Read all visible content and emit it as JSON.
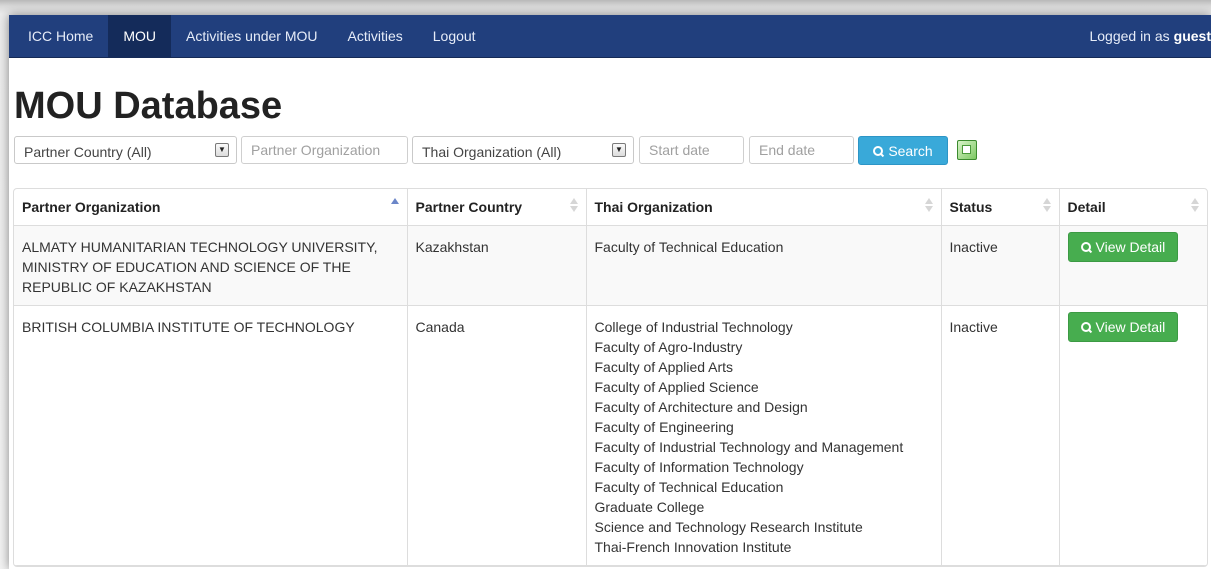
{
  "nav": {
    "items": [
      {
        "label": "ICC Home",
        "active": false
      },
      {
        "label": "MOU",
        "active": true
      },
      {
        "label": "Activities under MOU",
        "active": false
      },
      {
        "label": "Activities",
        "active": false
      },
      {
        "label": "Logout",
        "active": false
      }
    ],
    "login_prefix": "Logged in as",
    "login_user": "guest"
  },
  "page": {
    "title": "MOU Database"
  },
  "filters": {
    "partner_country": "Partner Country (All)",
    "partner_org_placeholder": "Partner Organization",
    "thai_org": "Thai Organization (All)",
    "start_date_placeholder": "Start date",
    "end_date_placeholder": "End date",
    "search_label": "Search"
  },
  "table": {
    "headers": [
      "Partner Organization",
      "Partner Country",
      "Thai Organization",
      "Status",
      "Detail"
    ],
    "sorted_column": "Partner Organization",
    "rows": [
      {
        "partner_org": "ALMATY HUMANITARIAN TECHNOLOGY UNIVERSITY, MINISTRY OF EDUCATION AND SCIENCE OF THE REPUBLIC OF KAZAKHSTAN",
        "country": "Kazakhstan",
        "thai_orgs": [
          "Faculty of Technical Education"
        ],
        "status": "Inactive",
        "detail_label": "View Detail"
      },
      {
        "partner_org": "BRITISH COLUMBIA INSTITUTE OF TECHNOLOGY",
        "country": "Canada",
        "thai_orgs": [
          "College of Industrial Technology",
          "Faculty of Agro-Industry",
          "Faculty of Applied Arts",
          "Faculty of Applied Science",
          "Faculty of Architecture and Design",
          "Faculty of Engineering",
          "Faculty of Industrial Technology and Management",
          "Faculty of Information Technology",
          "Faculty of Technical Education",
          "Graduate College",
          "Science and Technology Research Institute",
          "Thai-French Innovation Institute"
        ],
        "status": "Inactive",
        "detail_label": "View Detail"
      }
    ]
  },
  "colors": {
    "navbar": "#213f7d",
    "search_button": "#39a9d9",
    "detail_button": "#47ad4f"
  }
}
